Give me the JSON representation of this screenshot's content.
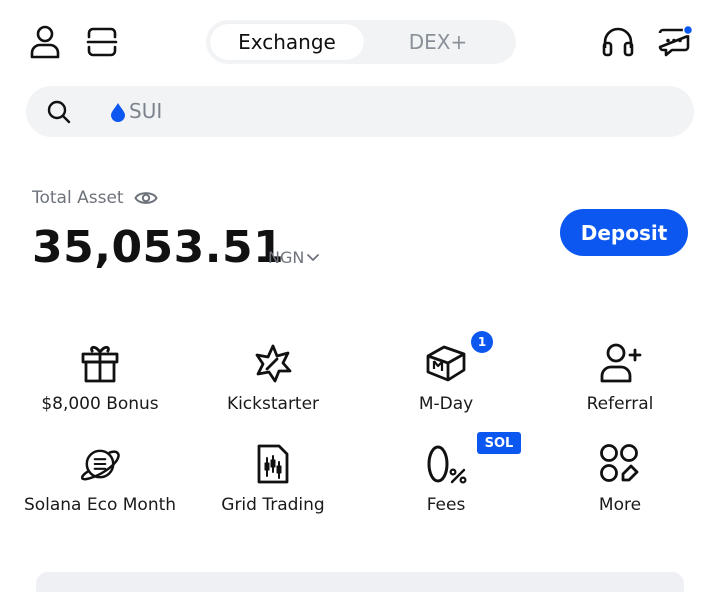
{
  "header": {
    "tabs": [
      {
        "label": "Exchange",
        "active": true
      },
      {
        "label": "DEX+",
        "active": false
      }
    ],
    "icons": [
      "user-icon",
      "scan-icon",
      "headphones-icon",
      "chat-icon"
    ],
    "notification_dot_color": "#0b57f0"
  },
  "search": {
    "text": "SUI",
    "token_icon": "droplet-icon",
    "icon_color": "#0b57f0"
  },
  "assets": {
    "label": "Total Asset",
    "amount": "35,053.51",
    "currency": "NGN",
    "deposit_label": "Deposit",
    "accent_color": "#0b57f0"
  },
  "shortcuts": [
    {
      "label": "$8,000 Bonus",
      "icon": "gift-icon"
    },
    {
      "label": "Kickstarter",
      "icon": "rocket-star-icon"
    },
    {
      "label": "M-Day",
      "icon": "m-day-cube-icon",
      "badge": "1"
    },
    {
      "label": "Referral",
      "icon": "add-user-icon"
    },
    {
      "label": "Solana Eco Month",
      "icon": "planet-icon"
    },
    {
      "label": "Grid Trading",
      "icon": "grid-trading-icon"
    },
    {
      "label": "Fees",
      "icon": "zero-fee-icon",
      "tag": "SOL"
    },
    {
      "label": "More",
      "icon": "more-apps-icon"
    }
  ]
}
